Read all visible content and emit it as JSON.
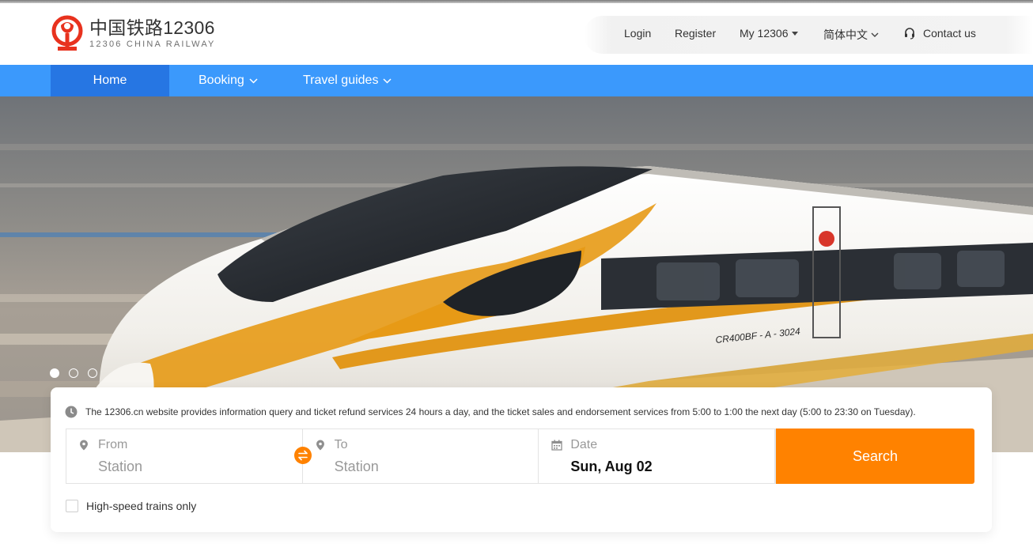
{
  "brand": {
    "title": "中国铁路12306",
    "subtitle": "12306 CHINA RAILWAY",
    "color": "#e8321e"
  },
  "topnav": {
    "login": "Login",
    "register": "Register",
    "my12306": "My 12306",
    "language": "简体中文",
    "contact": "Contact us"
  },
  "mainnav": {
    "tabs": [
      "Home",
      "Booking",
      "Travel guides"
    ],
    "active": "Home",
    "bg_color": "#3b99fc",
    "active_color": "#2676e3"
  },
  "hero": {
    "train_label": "CR400BF - A - 3024",
    "carousel_slides": 3,
    "active_slide": 1
  },
  "booking": {
    "notice": "The 12306.cn website provides information query and ticket refund services 24 hours a day, and the ticket sales and endorsement services from 5:00 to 1:00 the next day (5:00 to 23:30 on Tuesday).",
    "from": {
      "label": "From",
      "placeholder": "Station"
    },
    "to": {
      "label": "To",
      "placeholder": "Station"
    },
    "date": {
      "label": "Date",
      "value": "Sun, Aug 02"
    },
    "search_label": "Search",
    "search_color": "#ff8200",
    "high_speed_label": "High-speed trains only",
    "high_speed_checked": false
  }
}
